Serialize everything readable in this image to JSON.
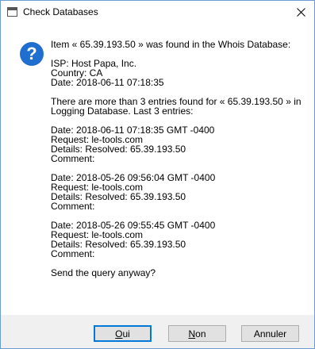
{
  "window": {
    "title": "Check Databases"
  },
  "icons": {
    "app": "window-icon",
    "close": "close-icon",
    "question": "question-icon"
  },
  "message": {
    "intro": "Item « 65.39.193.50 » was found in the Whois Database:",
    "isp": "ISP: Host Papa, Inc.",
    "country": "Country: CA",
    "date": "Date: 2018-06-11 07:18:35",
    "logging_line1": "There are more than 3 entries found for « 65.39.193.50 » in",
    "logging_line2": "Logging Database. Last 3 entries:",
    "entries": [
      {
        "date": "Date: 2018-06-11 07:18:35 GMT -0400",
        "request": "Request: le-tools.com",
        "details": "Details: Resolved: 65.39.193.50",
        "comment": "Comment:"
      },
      {
        "date": "Date: 2018-05-26 09:56:04 GMT -0400",
        "request": "Request: le-tools.com",
        "details": "Details: Resolved: 65.39.193.50",
        "comment": "Comment:"
      },
      {
        "date": "Date: 2018-05-26 09:55:45 GMT -0400",
        "request": "Request: le-tools.com",
        "details": "Details: Resolved: 65.39.193.50",
        "comment": "Comment:"
      }
    ],
    "question": "Send the query anyway?"
  },
  "buttons": {
    "oui": {
      "first": "O",
      "rest": "ui"
    },
    "non": {
      "first": "N",
      "rest": "on"
    },
    "annuler": "Annuler"
  },
  "colors": {
    "accent": "#0078d7",
    "icon_blue": "#1f6fd0",
    "footer": "#f0f0f0"
  }
}
